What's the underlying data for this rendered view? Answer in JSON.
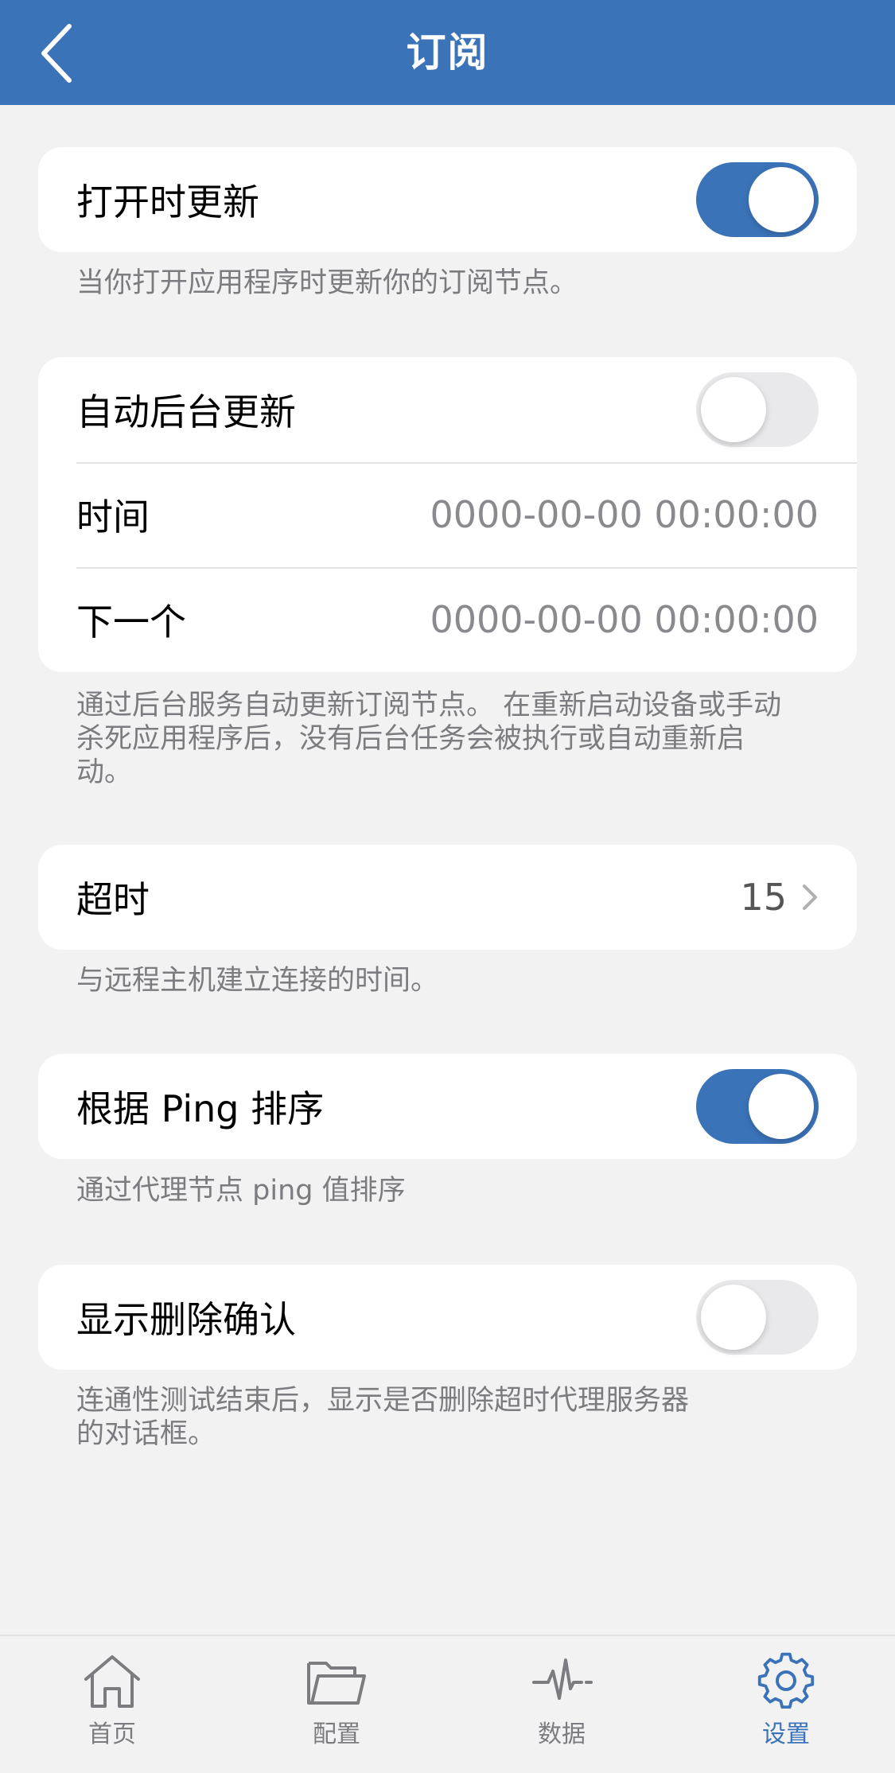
{
  "header": {
    "title": "订阅",
    "back_icon": "chevron-left-icon"
  },
  "update_on_open": {
    "label": "打开时更新",
    "enabled": true,
    "footnote": "当你打开应用程序时更新你的订阅节点。"
  },
  "auto_update": {
    "label": "自动后台更新",
    "enabled": false,
    "time_label": "时间",
    "time_value": "0000-00-00 00:00:00",
    "next_label": "下一个",
    "next_value": "0000-00-00 00:00:00",
    "footnote_line1": "通过后台服务自动更新订阅节点。 在重新启动设备或手动",
    "footnote_line2": "杀死应用程序后，没有后台任务会被执行或自动重新启",
    "footnote_line3": "动。"
  },
  "timeout": {
    "label": "超时",
    "value": "15",
    "footnote": "与远程主机建立连接的时间。"
  },
  "sort_by_ping": {
    "label": "根据 Ping 排序",
    "enabled": true,
    "footnote": "通过代理节点 ping 值排序"
  },
  "delete_confirm": {
    "label": "显示删除确认",
    "enabled": false,
    "footnote_line1": "连通性测试结束后，显示是否删除超时代理服务器",
    "footnote_line2": "的对话框。"
  },
  "tabbar": {
    "items": [
      {
        "label": "首页",
        "icon": "home-icon",
        "active": false
      },
      {
        "label": "配置",
        "icon": "folder-icon",
        "active": false
      },
      {
        "label": "数据",
        "icon": "pulse-icon",
        "active": false
      },
      {
        "label": "设置",
        "icon": "gear-icon",
        "active": true
      }
    ]
  },
  "colors": {
    "accent": "#3b73b9",
    "background": "#f2f2f2",
    "secondary_text": "#8a8a8e"
  }
}
